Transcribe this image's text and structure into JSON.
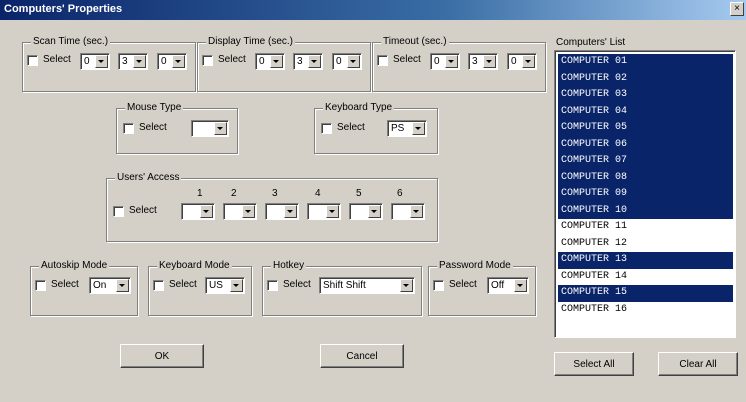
{
  "window": {
    "title": "Computers' Properties",
    "close_glyph": "×"
  },
  "common": {
    "select_label": "Select"
  },
  "scan_time": {
    "legend": "Scan Time (sec.)",
    "values": [
      "0",
      "3",
      "0"
    ]
  },
  "display_time": {
    "legend": "Display Time (sec.)",
    "values": [
      "0",
      "3",
      "0"
    ]
  },
  "timeout": {
    "legend": "Timeout (sec.)",
    "values": [
      "0",
      "3",
      "0"
    ]
  },
  "mouse_type": {
    "legend": "Mouse Type",
    "value": ""
  },
  "keyboard_type": {
    "legend": "Keyboard Type",
    "value": "PS"
  },
  "users_access": {
    "legend": "Users' Access",
    "numbers": [
      "1",
      "2",
      "3",
      "4",
      "5",
      "6"
    ]
  },
  "autoskip": {
    "legend": "Autoskip Mode",
    "value": "On"
  },
  "keyboard_mode": {
    "legend": "Keyboard Mode",
    "value": "US"
  },
  "hotkey": {
    "legend": "Hotkey",
    "value": "Shift Shift"
  },
  "password_mode": {
    "legend": "Password Mode",
    "value": "Off"
  },
  "buttons": {
    "ok": "OK",
    "cancel": "Cancel",
    "select_all": "Select All",
    "clear_all": "Clear All"
  },
  "computers_list": {
    "label": "Computers' List",
    "items": [
      {
        "name": "COMPUTER 01",
        "selected": true
      },
      {
        "name": "COMPUTER 02",
        "selected": true
      },
      {
        "name": "COMPUTER 03",
        "selected": true
      },
      {
        "name": "COMPUTER 04",
        "selected": true
      },
      {
        "name": "COMPUTER 05",
        "selected": true
      },
      {
        "name": "COMPUTER 06",
        "selected": true
      },
      {
        "name": "COMPUTER 07",
        "selected": true
      },
      {
        "name": "COMPUTER 08",
        "selected": true
      },
      {
        "name": "COMPUTER 09",
        "selected": true
      },
      {
        "name": "COMPUTER 10",
        "selected": true
      },
      {
        "name": "COMPUTER 11",
        "selected": false
      },
      {
        "name": "COMPUTER 12",
        "selected": false
      },
      {
        "name": "COMPUTER 13",
        "selected": true
      },
      {
        "name": "COMPUTER 14",
        "selected": false
      },
      {
        "name": "COMPUTER 15",
        "selected": true
      },
      {
        "name": "COMPUTER 16",
        "selected": false
      }
    ]
  },
  "colors": {
    "selection": "#0a246a",
    "face": "#d4d0c8"
  }
}
